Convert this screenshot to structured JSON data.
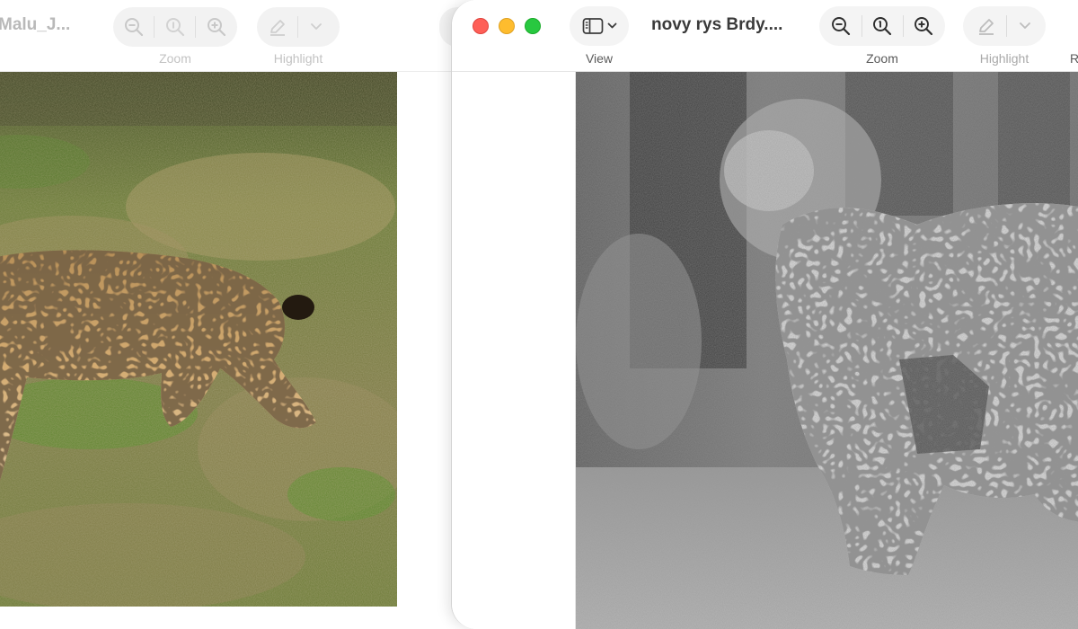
{
  "back_window": {
    "title": "Malu_J...",
    "toolbar": {
      "zoom_label": "Zoom",
      "highlight_label": "Highlight"
    },
    "image": {
      "description_icon": "photo-icon",
      "colors": {
        "grass": "#6f8a2e",
        "ground": "#8c7a4a",
        "fur": "#c9a061"
      }
    }
  },
  "front_window": {
    "title": "novy rys Brdy....",
    "toolbar": {
      "view_label": "View",
      "zoom_label": "Zoom",
      "highlight_label": "Highlight",
      "overflow_label": "R"
    },
    "traffic_lights": {
      "close": "#fe5f57",
      "minimize": "#febc2e",
      "maximize": "#28c840"
    },
    "image": {
      "mode": "grayscale"
    }
  }
}
